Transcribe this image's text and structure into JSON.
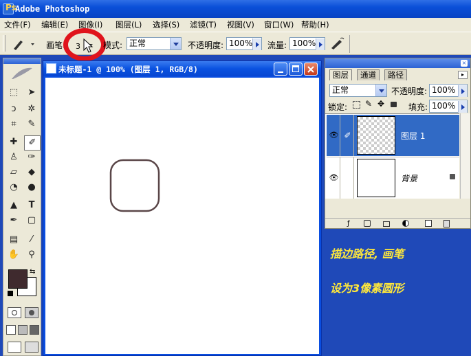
{
  "app": {
    "title": "Adobe Photoshop"
  },
  "menu": [
    "文件(F)",
    "编辑(E)",
    "图像(I)",
    "图层(L)",
    "选择(S)",
    "滤镜(T)",
    "视图(V)",
    "窗口(W)",
    "帮助(H)"
  ],
  "options": {
    "brush_label": "画笔:",
    "brush_size": "3",
    "mode_label": "模式:",
    "mode_value": "正常",
    "opacity_label": "不透明度:",
    "opacity_value": "100%",
    "flow_label": "流量:",
    "flow_value": "100%"
  },
  "document": {
    "title": "未标题-1 @ 100% (图层 1, RGB/8)"
  },
  "layers_panel": {
    "tabs": [
      "图层",
      "通道",
      "路径"
    ],
    "blend_mode": "正常",
    "opacity_label": "不透明度:",
    "opacity_value": "100%",
    "lock_label": "锁定:",
    "fill_label": "填充:",
    "fill_value": "100%",
    "layers": [
      {
        "name": "图层 1"
      },
      {
        "name": "背景"
      }
    ]
  },
  "tip": {
    "line1": "描边路径, 画笔",
    "line2": "设为3像素圆形"
  },
  "colors": {
    "foreground": "#3f2a2e",
    "background": "#ffffff",
    "highlight_circle": "#e0141c",
    "tip_text": "#ffe83a"
  }
}
